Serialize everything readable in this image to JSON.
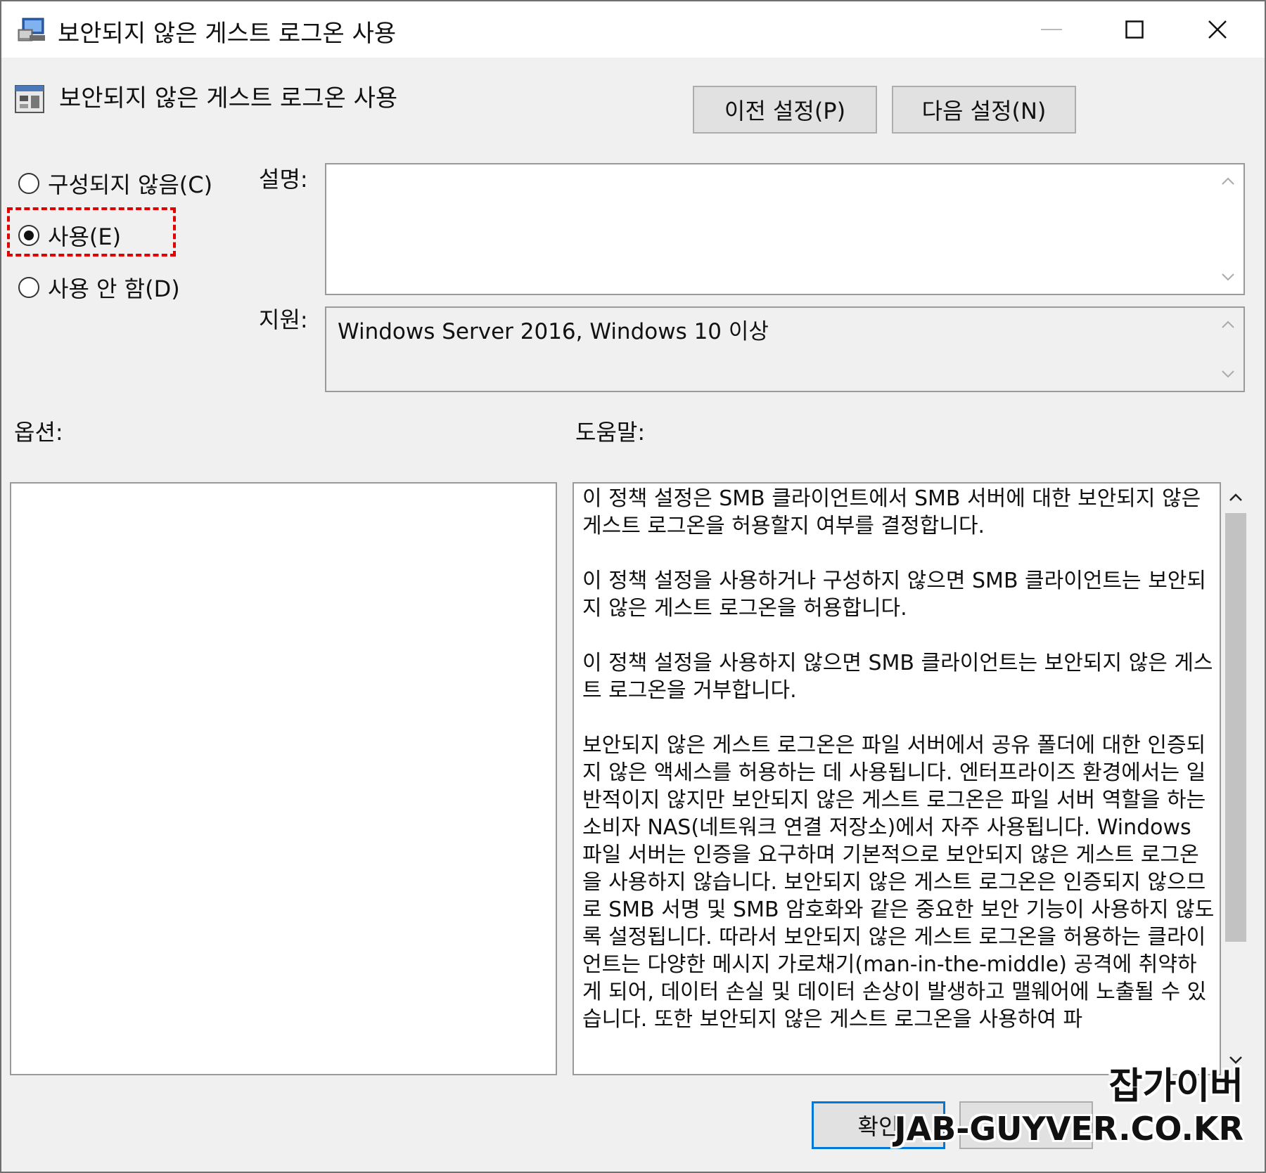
{
  "window": {
    "title": "보안되지 않은 게스트 로그온 사용"
  },
  "header": {
    "policy_name": "보안되지 않은 게스트 로그온 사용",
    "prev_button": "이전 설정(P)",
    "next_button": "다음 설정(N)"
  },
  "state": {
    "options": [
      {
        "label": "구성되지 않음(C)",
        "checked": false
      },
      {
        "label": "사용(E)",
        "checked": true
      },
      {
        "label": "사용 안 함(D)",
        "checked": false
      }
    ]
  },
  "fields": {
    "description_label": "설명:",
    "description_value": "",
    "support_label": "지원:",
    "support_value": "Windows Server 2016, Windows 10 이상"
  },
  "sections": {
    "options_label": "옵션:",
    "help_label": "도움말:"
  },
  "help": {
    "paragraphs": [
      "이 정책 설정은 SMB 클라이언트에서 SMB 서버에 대한 보안되지 않은 게스트 로그온을 허용할지 여부를 결정합니다.",
      "이 정책 설정을 사용하거나 구성하지 않으면 SMB 클라이언트는 보안되지 않은 게스트 로그온을 허용합니다.",
      "이 정책 설정을 사용하지 않으면 SMB 클라이언트는 보안되지 않은 게스트 로그온을 거부합니다.",
      "보안되지 않은 게스트 로그온은 파일 서버에서 공유 폴더에 대한 인증되지 않은 액세스를 허용하는 데 사용됩니다. 엔터프라이즈 환경에서는 일반적이지 않지만 보안되지 않은 게스트 로그온은 파일 서버 역할을 하는 소비자 NAS(네트워크 연결 저장소)에서 자주 사용됩니다. Windows 파일 서버는 인증을 요구하며 기본적으로 보안되지 않은 게스트 로그온을 사용하지 않습니다. 보안되지 않은 게스트 로그온은 인증되지 않으므로 SMB 서명 및 SMB 암호화와 같은 중요한 보안 기능이 사용하지 않도록 설정됩니다. 따라서 보안되지 않은 게스트 로그온을 허용하는 클라이언트는 다양한 메시지 가로채기(man-in-the-middle) 공격에 취약하게 되어, 데이터 손실 및 데이터 손상이 발생하고 맬웨어에 노출될 수 있습니다. 또한 보안되지 않은 게스트 로그온을 사용하여 파"
    ]
  },
  "footer": {
    "ok_button": "확인",
    "cancel_button": ""
  },
  "watermark": {
    "line1": "잡가이버",
    "line2": "JAB-GUYVER.CO.KR"
  },
  "colors": {
    "highlight": "#e00000",
    "focus_border": "#0078d7",
    "dialog_bg": "#f0f0f0"
  }
}
